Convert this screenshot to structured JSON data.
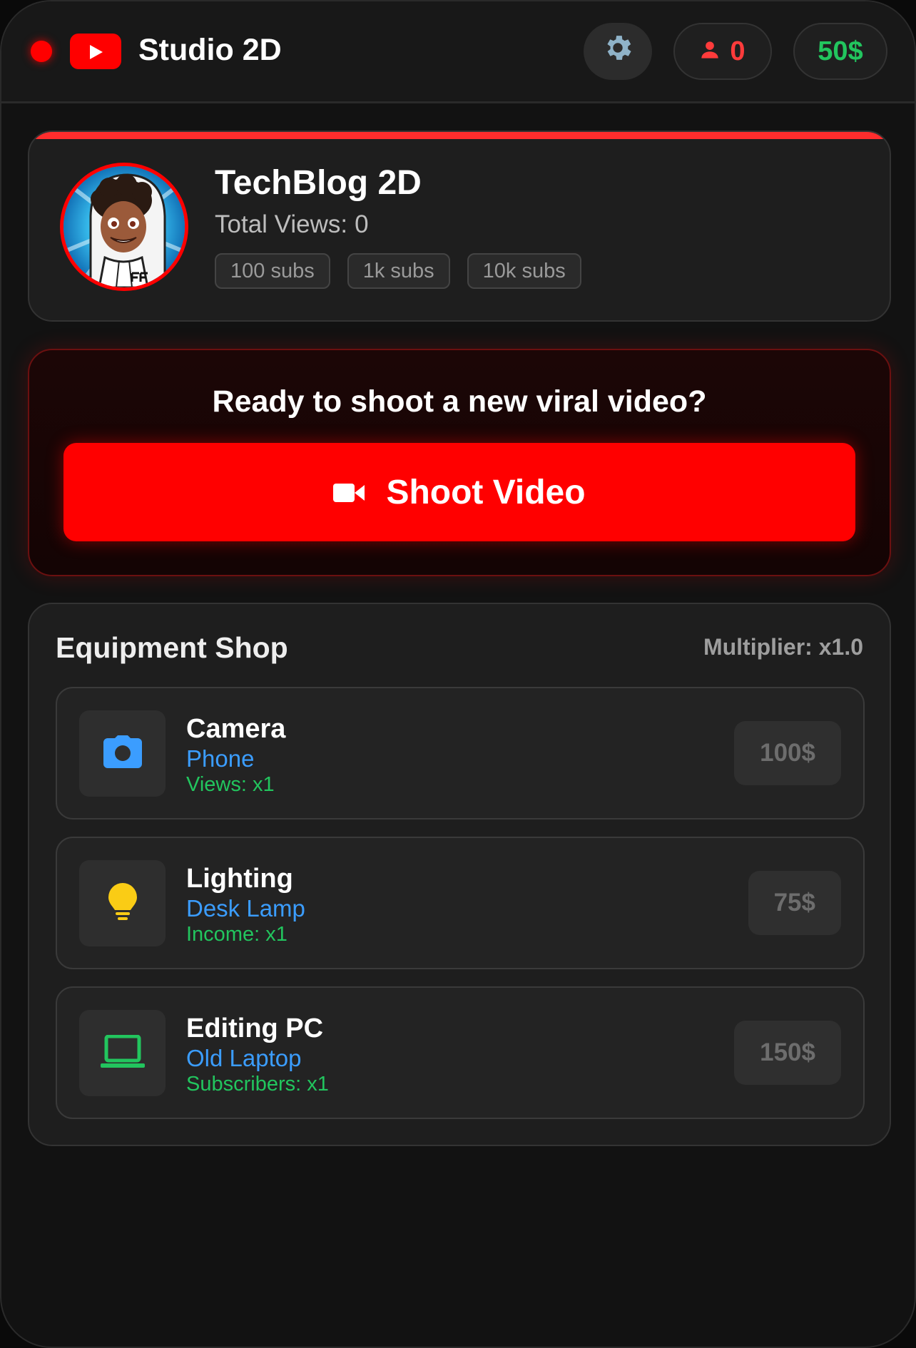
{
  "header": {
    "app_title": "Studio 2D",
    "subscribers": "0",
    "money": "50$"
  },
  "profile": {
    "channel_name": "TechBlog 2D",
    "views_label": "Total Views:",
    "total_views": "0",
    "milestones": [
      "100 subs",
      "1k subs",
      "10k subs"
    ]
  },
  "shoot": {
    "prompt": "Ready to shoot a new viral video?",
    "button_label": "Shoot Video"
  },
  "shop": {
    "title": "Equipment Shop",
    "multiplier": "Multiplier: x1.0",
    "items": [
      {
        "category": "Camera",
        "name": "Phone",
        "effect": "Views: x1",
        "price": "100$",
        "icon": "camera-icon",
        "icon_color": "#3b9dff"
      },
      {
        "category": "Lighting",
        "name": "Desk Lamp",
        "effect": "Income: x1",
        "price": "75$",
        "icon": "lightbulb-icon",
        "icon_color": "#facc15"
      },
      {
        "category": "Editing PC",
        "name": "Old Laptop",
        "effect": "Subscribers: x1",
        "price": "150$",
        "icon": "laptop-icon",
        "icon_color": "#22c55e"
      }
    ]
  },
  "colors": {
    "accent": "#ff0000",
    "money": "#22c55e",
    "link": "#3b9dff"
  }
}
